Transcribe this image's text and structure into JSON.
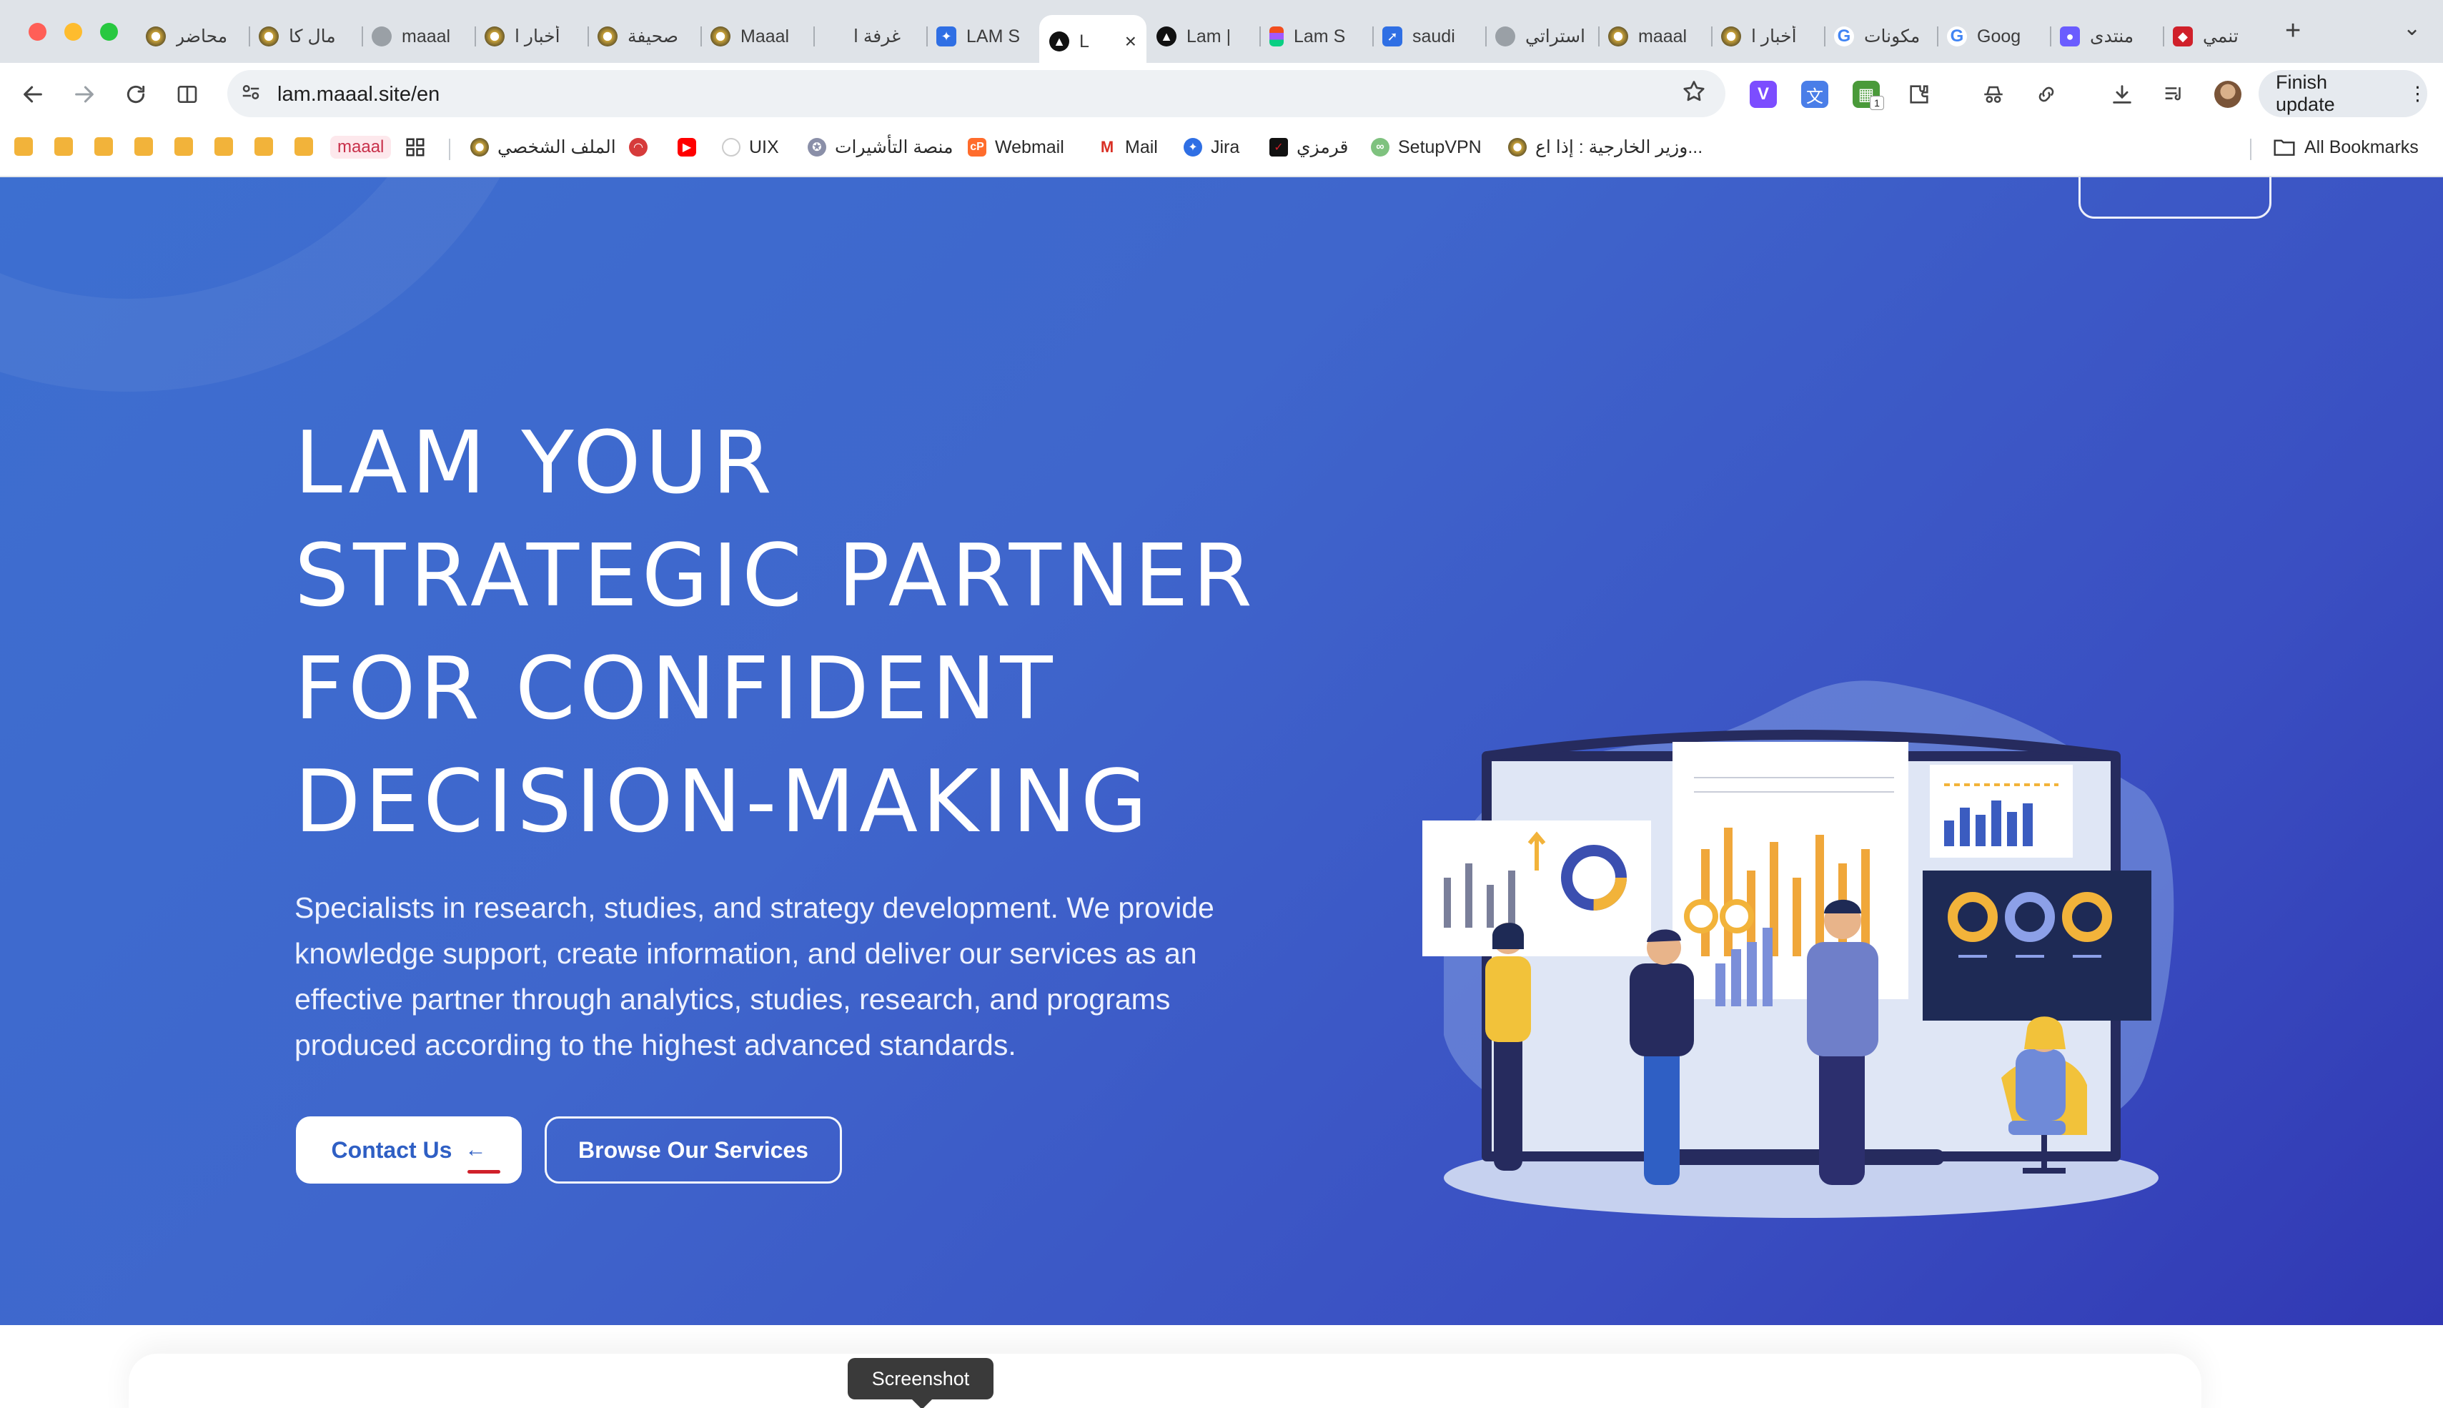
{
  "browser": {
    "tabs": [
      {
        "label": "محاضر",
        "favicon": "maaal-logo-icon"
      },
      {
        "label": "مال كا",
        "favicon": "maaal-logo-icon"
      },
      {
        "label": "maaal",
        "favicon": "globe-icon"
      },
      {
        "label": "أخبار ا",
        "favicon": "maaal-logo-icon"
      },
      {
        "label": "صحيفة",
        "favicon": "maaal-logo-icon"
      },
      {
        "label": "Maaal",
        "favicon": "maaal-logo-icon"
      },
      {
        "label": "غرفة ا",
        "favicon": "blank-icon"
      },
      {
        "label": "LAM S",
        "favicon": "lam-icon"
      },
      {
        "label": "L",
        "favicon": "triangle-icon",
        "active": true
      },
      {
        "label": "Lam |",
        "favicon": "triangle-icon"
      },
      {
        "label": "Lam S",
        "favicon": "figma-icon"
      },
      {
        "label": "saudi",
        "favicon": "arrow-icon"
      },
      {
        "label": "استراتي",
        "favicon": "globe-icon"
      },
      {
        "label": "maaal",
        "favicon": "maaal-logo-icon"
      },
      {
        "label": "أخبار ا",
        "favicon": "maaal-logo-icon"
      },
      {
        "label": "مكونات",
        "favicon": "google-icon"
      },
      {
        "label": "Goog",
        "favicon": "google-icon"
      },
      {
        "label": "منتدى",
        "favicon": "forum-icon"
      },
      {
        "label": "تنمي",
        "favicon": "red-logo-icon"
      }
    ],
    "tab_close": "×",
    "new_tab": "+",
    "tab_menu": "⌄",
    "url": "lam.maaal.site/en",
    "update_label": "Finish update",
    "update_menu": "⋮",
    "bookmarks": [
      {
        "label": "maaal"
      },
      {
        "label": "الملف الشخصي"
      },
      {
        "label": "UIX"
      },
      {
        "label": "منصة التأشيرات"
      },
      {
        "label": "Webmail"
      },
      {
        "label": "Mail"
      },
      {
        "label": "Jira"
      },
      {
        "label": "قرمزي"
      },
      {
        "label": "SetupVPN"
      },
      {
        "label": "وزير الخارجية : إذا اع..."
      }
    ],
    "all_bookmarks": "All Bookmarks",
    "extension_badge": "1"
  },
  "hero": {
    "title_lines": [
      "LAM YOUR",
      "STRATEGIC PARTNER",
      "FOR CONFIDENT",
      "DECISION-MAKING"
    ],
    "description": "Specialists in research, studies, and strategy development. We provide knowledge support, create information, and deliver our services as an effective partner through analytics, studies, research, and programs produced according to the highest advanced standards.",
    "contact_label": "Contact Us",
    "contact_arrow": "←",
    "browse_label": "Browse Our Services"
  },
  "tooltip": "Screenshot",
  "colors": {
    "hero_start": "#3d6fd0",
    "hero_end": "#3138b3",
    "accent_red": "#d0202a",
    "accent_gold": "#f2b33a"
  }
}
